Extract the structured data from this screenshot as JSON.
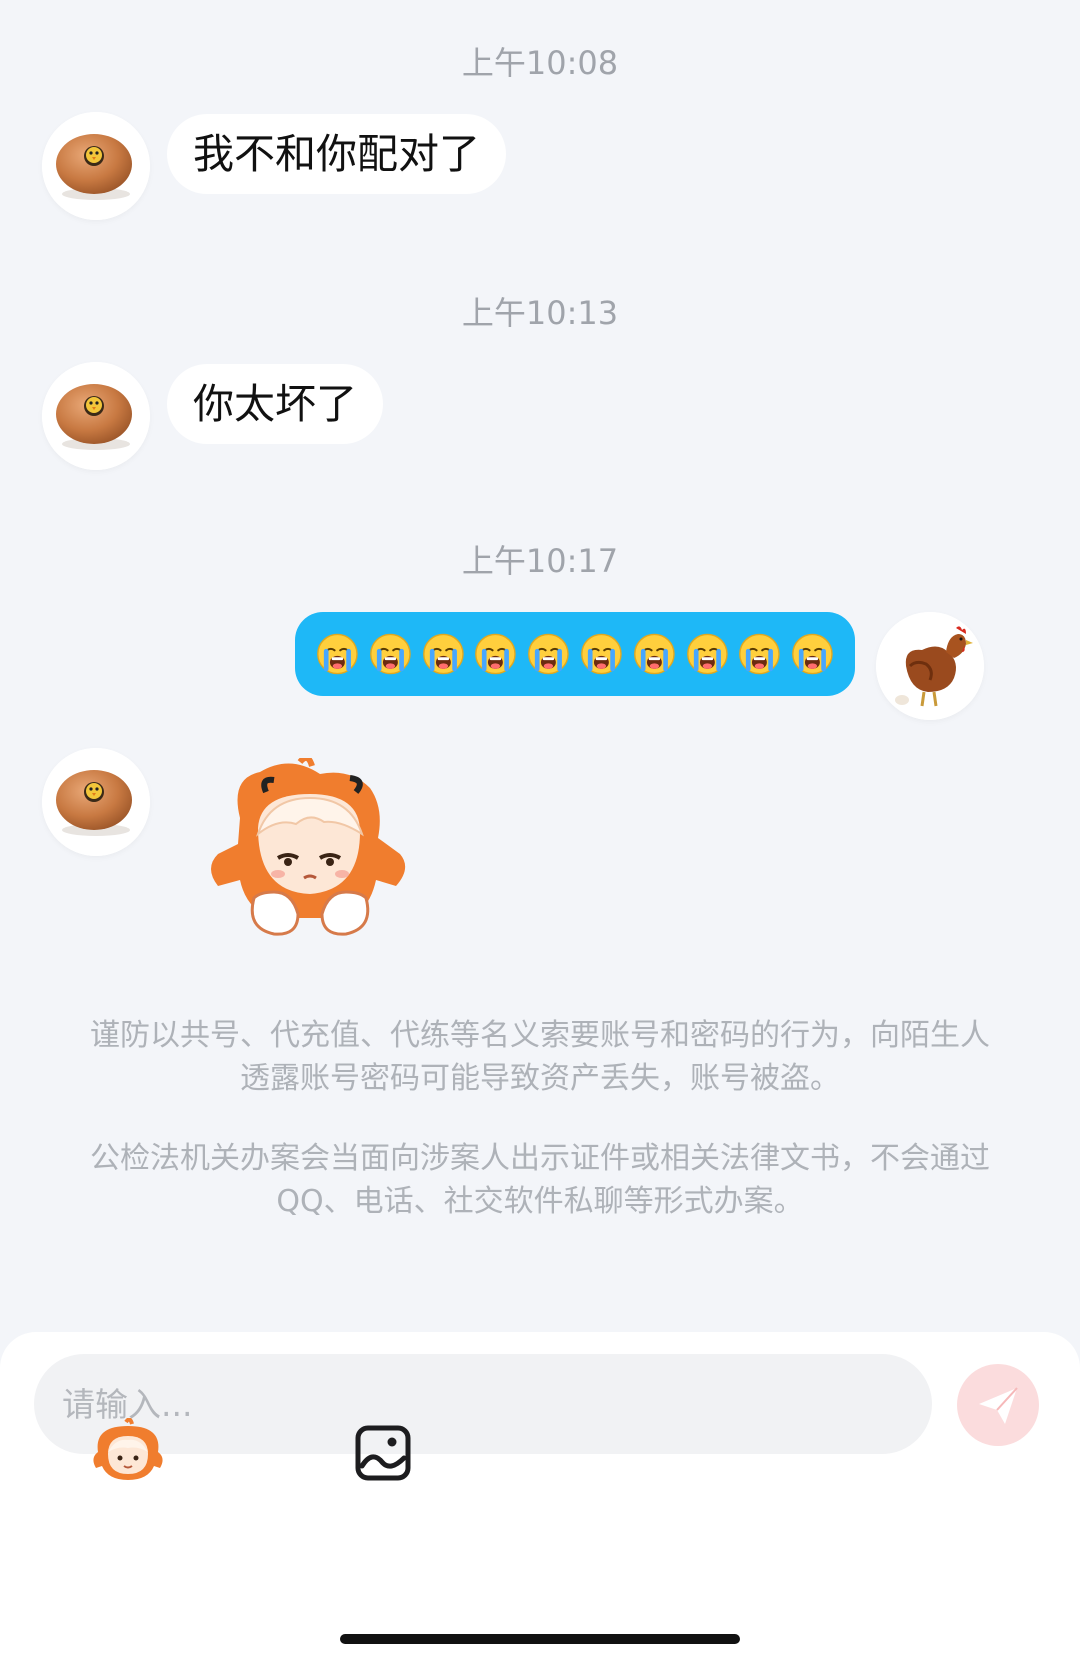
{
  "messages": [
    {
      "time": "上午10:08",
      "text": "我不和你配对了"
    },
    {
      "time": "上午10:13",
      "text": "你太坏了"
    },
    {
      "time": "上午10:17",
      "emoji": "loudly-crying-face",
      "emoji_count": 10
    }
  ],
  "notices": [
    "谨防以共号、代充值、代练等名义索要账号和密码的行为，向陌生人透露账号密码可能导致资产丢失，账号被盗。",
    "公检法机关办案会当面向涉案人出示证件或相关法律文书，不会通过QQ、电话、社交软件私聊等形式办案。"
  ],
  "composer": {
    "placeholder": "请输入...",
    "send_icon": "paper-plane-icon",
    "tool_icons": [
      "sticker-avatar-icon",
      "image-icon"
    ]
  },
  "colors": {
    "background": "#f3f5f9",
    "outgoing_bubble": "#1eb8f7",
    "incoming_bubble": "#ffffff",
    "send_button": "#fbdcdd",
    "sticker_hair": "#f07d2e"
  }
}
